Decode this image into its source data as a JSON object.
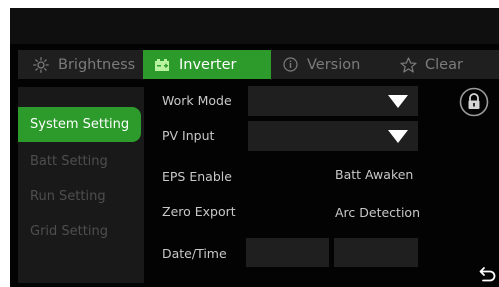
{
  "tabs": [
    {
      "label": "Brightness",
      "icon": "sun-icon"
    },
    {
      "label": "Inverter",
      "icon": "battery-icon"
    },
    {
      "label": "Version",
      "icon": "info-icon"
    },
    {
      "label": "Clear",
      "icon": "star-icon"
    }
  ],
  "active_tab": "Inverter",
  "sidebar": {
    "items": [
      {
        "label": "System Setting"
      },
      {
        "label": "Batt Setting"
      },
      {
        "label": "Run Setting"
      },
      {
        "label": "Grid Setting"
      }
    ],
    "active": "System Setting"
  },
  "form": {
    "work_mode": {
      "label": "Work Mode",
      "value": ""
    },
    "pv_input": {
      "label": "PV Input",
      "value": ""
    },
    "eps_enable": {
      "label": "EPS Enable"
    },
    "batt_awaken": {
      "label": "Batt Awaken"
    },
    "zero_export": {
      "label": "Zero Export"
    },
    "arc_detection": {
      "label": "Arc Detection"
    },
    "date_time": {
      "label": "Date/Time",
      "date": "",
      "time": ""
    }
  },
  "icons": {
    "lock": "lock-icon",
    "back": "back-arrow-icon"
  },
  "colors": {
    "accent": "#2c9b2c",
    "background": "#030303",
    "panel": "#1f1f1f"
  }
}
